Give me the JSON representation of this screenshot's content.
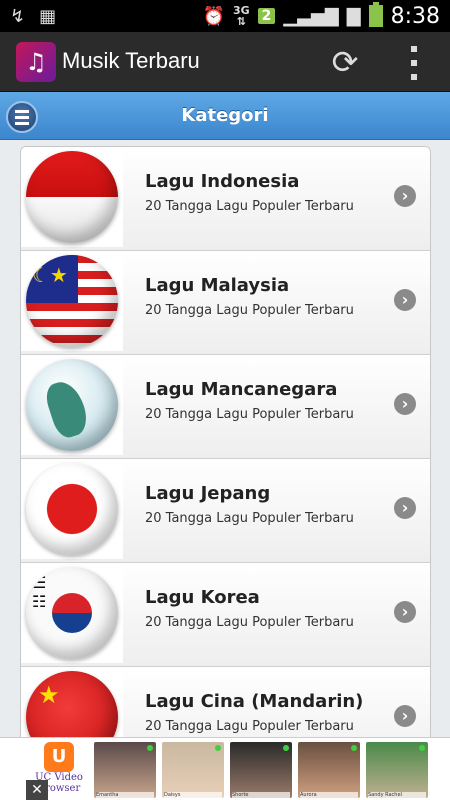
{
  "status_bar": {
    "time": "8:38",
    "network": "3G",
    "badge": "2",
    "icons": [
      "signal-icon",
      "battery-icon",
      "alarm-icon",
      "chat-icon"
    ]
  },
  "action_bar": {
    "title": "Musik Terbaru",
    "app_icon": "♫",
    "refresh_icon": "⟳"
  },
  "category_bar": {
    "title": "Kategori"
  },
  "categories": [
    {
      "title": "Lagu Indonesia",
      "subtitle": "20 Tangga Lagu Populer Terbaru"
    },
    {
      "title": "Lagu Malaysia",
      "subtitle": "20 Tangga Lagu Populer Terbaru"
    },
    {
      "title": "Lagu Mancanegara",
      "subtitle": "20 Tangga Lagu Populer Terbaru"
    },
    {
      "title": "Lagu Jepang",
      "subtitle": "20 Tangga Lagu Populer Terbaru"
    },
    {
      "title": "Lagu Korea",
      "subtitle": "20 Tangga Lagu Populer Terbaru"
    },
    {
      "title": "Lagu Cina (Mandarin)",
      "subtitle": "20 Tangga Lagu Populer Terbaru"
    }
  ],
  "ad": {
    "brand_line1": "UC Video",
    "brand_line2": "Browser",
    "close": "✕",
    "names": [
      "Emantha",
      "Daisys",
      "Shorte",
      "Aurora",
      "Sandy Rachel"
    ]
  },
  "colors": {
    "accent": "#3b86cd",
    "action_bar": "#2b2b2b"
  }
}
